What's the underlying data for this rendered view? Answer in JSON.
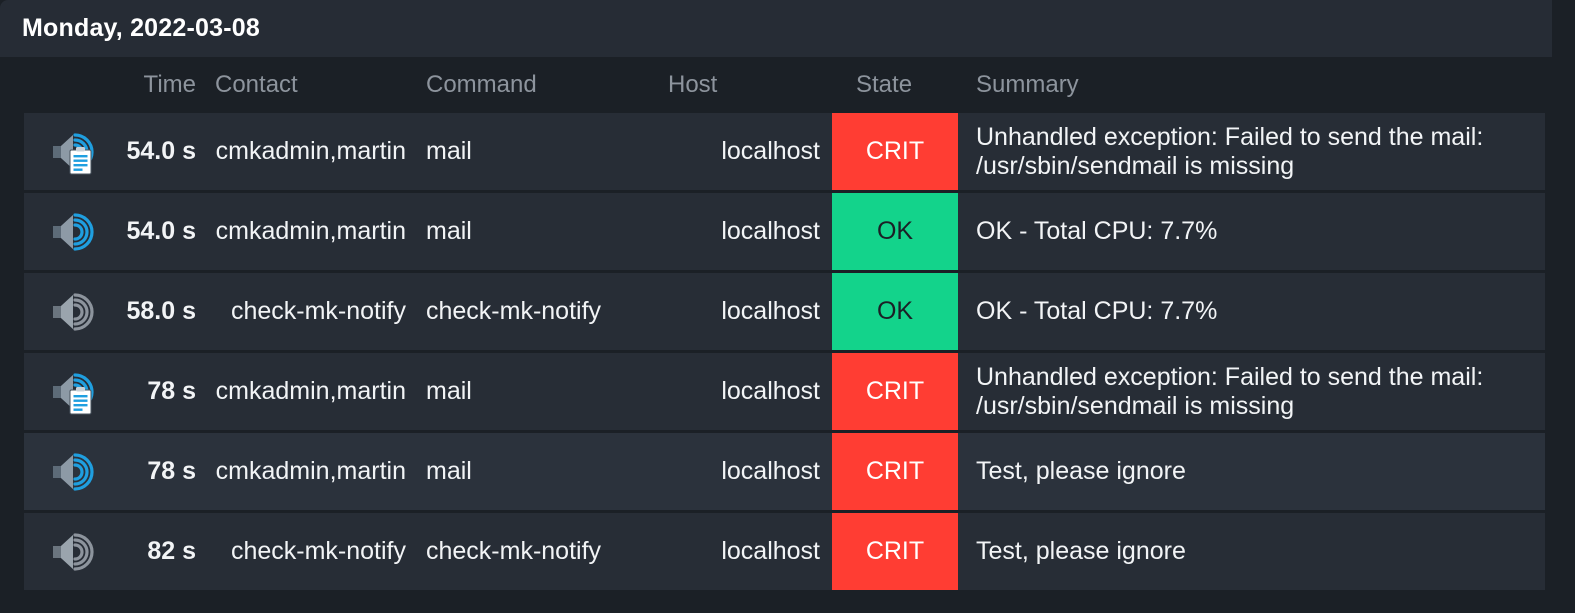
{
  "titlebar": {
    "title": "Monday, 2022-03-08"
  },
  "table": {
    "columns": [
      {
        "key": "icon",
        "label": ""
      },
      {
        "key": "time",
        "label": "Time"
      },
      {
        "key": "contact",
        "label": "Contact"
      },
      {
        "key": "command",
        "label": "Command"
      },
      {
        "key": "host",
        "label": "Host"
      },
      {
        "key": "state",
        "label": "State"
      },
      {
        "key": "summary",
        "label": "Summary"
      }
    ],
    "rows": [
      {
        "icon": "speaker-document-icon",
        "time": "54.0 s",
        "contact": "cmkadmin,martin",
        "command": "mail",
        "host": "localhost",
        "state": "CRIT",
        "summary": "Unhandled exception: Failed to send the mail: /usr/sbin/sendmail is missing",
        "highlighted": false
      },
      {
        "icon": "speaker-active-icon",
        "time": "54.0 s",
        "contact": "cmkadmin,martin",
        "command": "mail",
        "host": "localhost",
        "state": "OK",
        "summary": "OK - Total CPU: 7.7%",
        "highlighted": false
      },
      {
        "icon": "speaker-muted-icon",
        "time": "58.0 s",
        "contact": "check-mk-notify",
        "command": "check-mk-notify",
        "host": "localhost",
        "state": "OK",
        "summary": "OK - Total CPU: 7.7%",
        "highlighted": false
      },
      {
        "icon": "speaker-document-icon",
        "time": "78 s",
        "contact": "cmkadmin,martin",
        "command": "mail",
        "host": "localhost",
        "state": "CRIT",
        "summary": "Unhandled exception: Failed to send the mail: /usr/sbin/sendmail is missing",
        "highlighted": false
      },
      {
        "icon": "speaker-active-icon",
        "time": "78 s",
        "contact": "cmkadmin,martin",
        "command": "mail",
        "host": "localhost",
        "state": "CRIT",
        "summary": "Test, please ignore",
        "highlighted": true
      },
      {
        "icon": "speaker-muted-icon",
        "time": "82 s",
        "contact": "check-mk-notify",
        "command": "check-mk-notify",
        "host": "localhost",
        "state": "CRIT",
        "summary": "Test, please ignore",
        "highlighted": false
      }
    ]
  },
  "colors": {
    "page_background": "#1b2026",
    "titlebar_background": "#262c35",
    "row_background": "#272d36",
    "row_background_highlight": "#2b323c",
    "header_text": "#8d949d",
    "body_text": "#f2f4f6",
    "state_crit": "#ff3d33",
    "state_ok": "#13d38b",
    "icon_blue": "#1f9fe0",
    "icon_grey": "#8d949d",
    "icon_speaker": "#7a8894"
  }
}
